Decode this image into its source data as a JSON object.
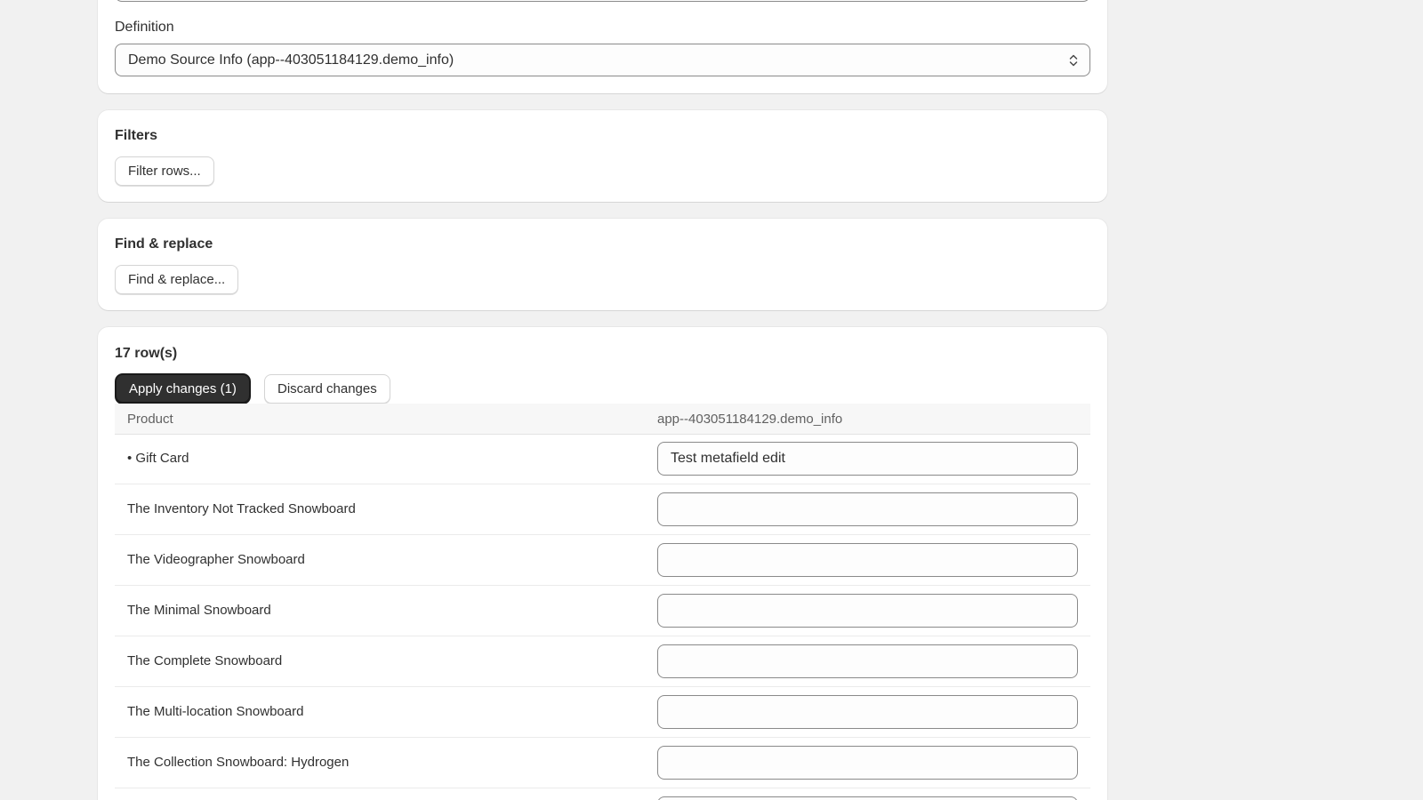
{
  "definition": {
    "label": "Definition",
    "selected": "Demo Source Info (app--403051184129.demo_info)"
  },
  "filters": {
    "title": "Filters",
    "button": "Filter rows..."
  },
  "find_replace": {
    "title": "Find & replace",
    "button": "Find & replace..."
  },
  "results": {
    "count_label": "17 row(s)",
    "apply_button": "Apply changes (1)",
    "discard_button": "Discard changes",
    "columns": [
      "Product",
      "app--403051184129.demo_info"
    ],
    "rows": [
      {
        "product": "• Gift Card",
        "value": "Test metafield edit"
      },
      {
        "product": "The Inventory Not Tracked Snowboard",
        "value": ""
      },
      {
        "product": "The Videographer Snowboard",
        "value": ""
      },
      {
        "product": "The Minimal Snowboard",
        "value": ""
      },
      {
        "product": "The Complete Snowboard",
        "value": ""
      },
      {
        "product": "The Multi-location Snowboard",
        "value": ""
      },
      {
        "product": "The Collection Snowboard: Hydrogen",
        "value": ""
      },
      {
        "product": "",
        "value": ""
      }
    ]
  },
  "colors": {
    "page_background": "#f1f1f1",
    "card_background": "#ffffff",
    "primary_button": "#303030",
    "border": "#8a8a8a"
  }
}
